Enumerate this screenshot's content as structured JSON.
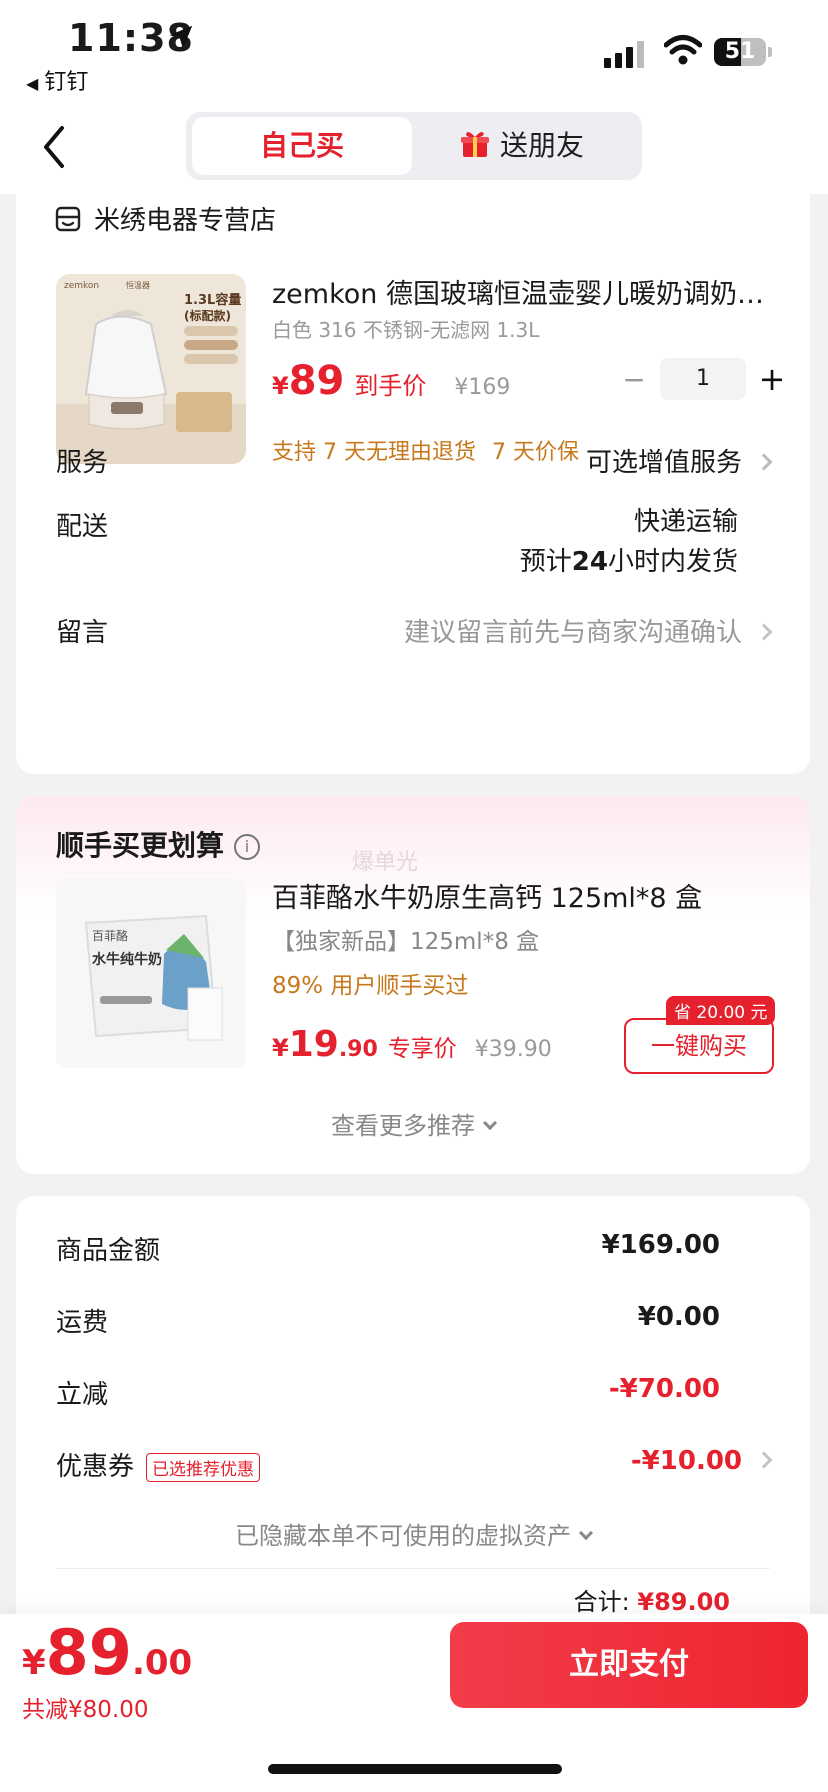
{
  "status_bar": {
    "time": "11:38",
    "back_app": "钉钉",
    "battery": "51"
  },
  "nav": {
    "tab_self": "自己买",
    "tab_gift": "送朋友"
  },
  "store": {
    "name": "米绣电器专营店"
  },
  "product": {
    "title": "zemkon 德国玻璃恒温壶婴儿暖奶调奶…",
    "spec": "白色 316 不锈钢-无滤网 1.3L",
    "price_symbol": "¥",
    "price": "89",
    "price_tag": "到手价",
    "orig_price": "¥169",
    "quantity": "1",
    "promise1": "支持 7 天无理由退货",
    "promise2": "7 天价保",
    "image_text": {
      "brand": "zemkon",
      "kind": "恒温器",
      "cap1": "1.3L容量",
      "cap2": "(标配款)"
    }
  },
  "rows": {
    "service_label": "服务",
    "service_value": "可选增值服务",
    "delivery_label": "配送",
    "delivery_value1": "快递运输",
    "delivery_value2_pre": "预计",
    "delivery_value2_num": "24",
    "delivery_value2_post": "小时内发货",
    "message_label": "留言",
    "message_value": "建议留言前先与商家沟通确认"
  },
  "addon": {
    "section_title": "顺手买更划算",
    "info_icon": "i",
    "watermark": "爆单光",
    "title": "百菲酪水牛奶原生高钙 125ml*8 盒",
    "spec": "【独家新品】125ml*8 盒",
    "buyers": "89% 用户顺手买过",
    "price_symbol": "¥",
    "price_int": "19",
    "price_dec": ".90",
    "price_tag": "专享价",
    "orig_price": "¥39.90",
    "save_badge": "省 20.00 元",
    "buy_button": "一键购买",
    "image_brand": "百菲酪",
    "image_text": "水牛纯牛奶",
    "more": "查看更多推荐"
  },
  "summary": {
    "goods_label": "商品金额",
    "goods_value": "¥169.00",
    "shipping_label": "运费",
    "shipping_value": "¥0.00",
    "discount_label": "立减",
    "discount_value": "-¥70.00",
    "coupon_label": "优惠券",
    "coupon_badge": "已选推荐优惠",
    "coupon_value": "-¥10.00",
    "hidden_assets": "已隐藏本单不可使用的虚拟资产",
    "total_label": "合计:",
    "total_value": "¥89.00"
  },
  "footer": {
    "price_symbol": "¥",
    "price_int": "89",
    "price_dec": ".00",
    "saved": "共减¥80.00",
    "pay_button": "立即支付"
  },
  "colors": {
    "accent": "#e5212e",
    "promo": "#c8781c"
  }
}
